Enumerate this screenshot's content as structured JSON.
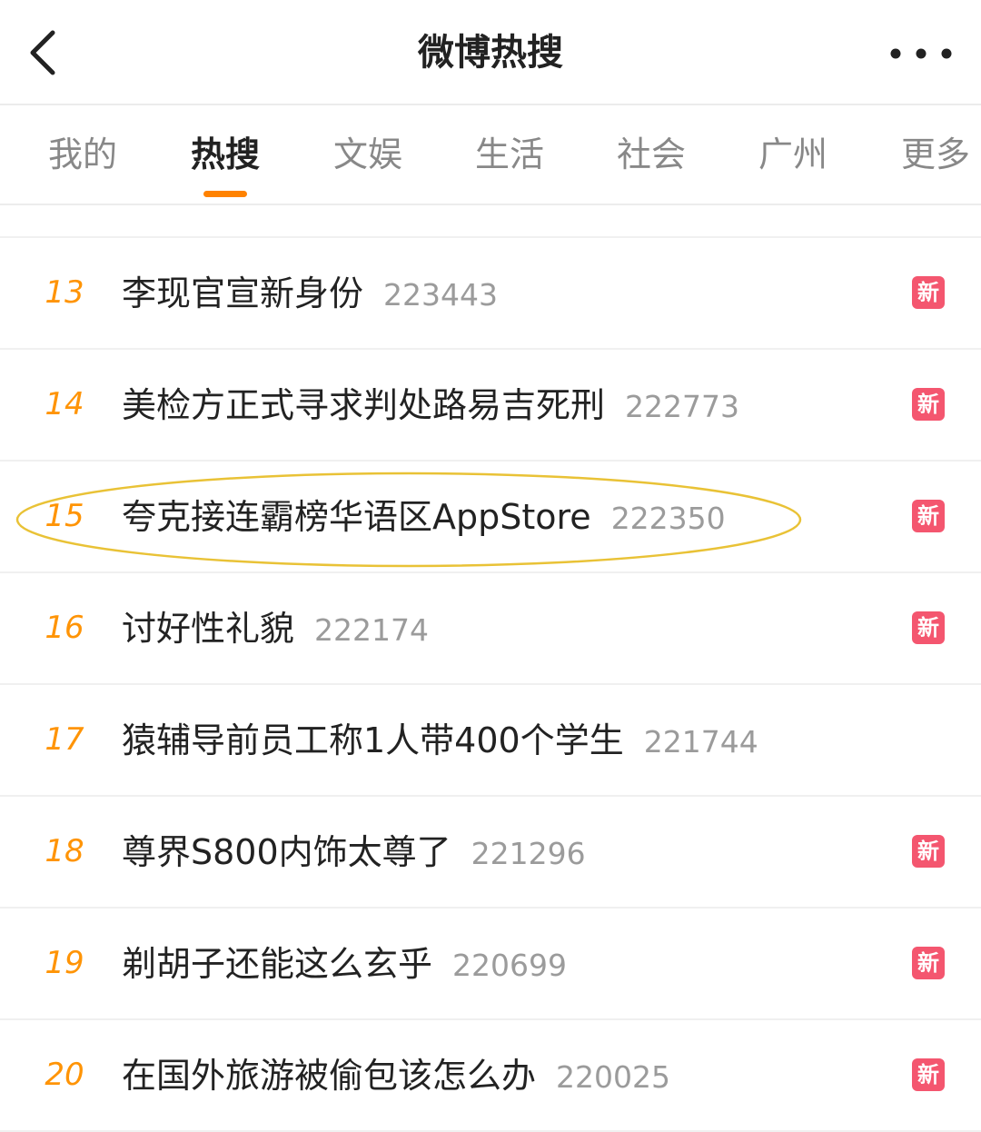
{
  "header": {
    "title": "微博热搜",
    "back_icon": "chevron-left-icon",
    "more_icon": "more-horizontal-icon"
  },
  "tabs": [
    {
      "label": "我的",
      "active": false
    },
    {
      "label": "热搜",
      "active": true
    },
    {
      "label": "文娱",
      "active": false
    },
    {
      "label": "生活",
      "active": false
    },
    {
      "label": "社会",
      "active": false
    },
    {
      "label": "广州",
      "active": false
    },
    {
      "label": "更多",
      "active": false
    }
  ],
  "colors": {
    "accent": "#ff8200",
    "rank": "#ff9406",
    "badge_new": "#f4566f",
    "highlight": "#e9c236"
  },
  "list": [
    {
      "rank": "13",
      "title": "李现官宣新身份",
      "count": "223443",
      "badge": "新"
    },
    {
      "rank": "14",
      "title": "美检方正式寻求判处路易吉死刑",
      "count": "222773",
      "badge": "新"
    },
    {
      "rank": "15",
      "title": "夸克接连霸榜华语区AppStore",
      "count": "222350",
      "badge": "新"
    },
    {
      "rank": "16",
      "title": "讨好性礼貌",
      "count": "222174",
      "badge": "新"
    },
    {
      "rank": "17",
      "title": "猿辅导前员工称1人带400个学生",
      "count": "221744",
      "badge": ""
    },
    {
      "rank": "18",
      "title": "尊界S800内饰太尊了",
      "count": "221296",
      "badge": "新"
    },
    {
      "rank": "19",
      "title": "剃胡子还能这么玄乎",
      "count": "220699",
      "badge": "新"
    },
    {
      "rank": "20",
      "title": "在国外旅游被偷包该怎么办",
      "count": "220025",
      "badge": "新"
    }
  ]
}
